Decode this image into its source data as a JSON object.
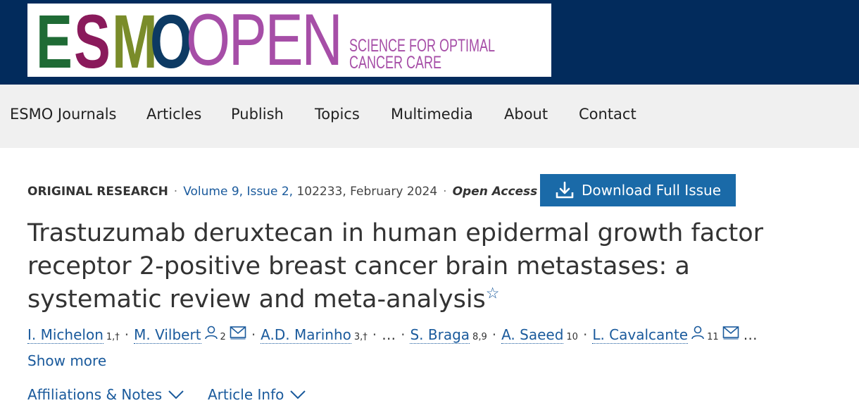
{
  "header": {
    "logo": {
      "esmo_letters": [
        "E",
        "S",
        "M",
        "O"
      ],
      "esmo_colors": [
        "#1f6b35",
        "#8a1a5b",
        "#7a8c2a",
        "#0d3a63"
      ],
      "open": "OPEN",
      "tagline_line1": "SCIENCE FOR OPTIMAL",
      "tagline_line2": "CANCER CARE"
    },
    "background": "#022b5c"
  },
  "nav": {
    "items": [
      "ESMO Journals",
      "Articles",
      "Publish",
      "Topics",
      "Multimedia",
      "About",
      "Contact"
    ]
  },
  "article": {
    "type": "ORIGINAL RESEARCH",
    "volume_issue": "Volume 9, Issue 2,",
    "article_number_date": "102233, February 2024",
    "access": "Open Access",
    "download_label": "Download Full Issue",
    "title": "Trastuzumab deruxtecan in human epidermal growth factor receptor 2-positive breast cancer brain metastases: a systematic review and meta-analysis",
    "star": "☆"
  },
  "authors": [
    {
      "name": "I. Michelon",
      "sup": "1,†"
    },
    {
      "name": "M. Vilbert",
      "sup": "2"
    },
    {
      "name": "A.D. Marinho",
      "sup": "3,†"
    },
    {
      "ellipsis": "…"
    },
    {
      "name": "S. Braga",
      "sup": "8,9"
    },
    {
      "name": "A. Saeed",
      "sup": "10"
    },
    {
      "name": "L. Cavalcante",
      "sup": "11"
    },
    {
      "trailing": "…"
    }
  ],
  "show_more": "Show more",
  "toggles": {
    "affiliations": "Affiliations & Notes",
    "article_info": "Article Info"
  },
  "colors": {
    "link": "#1a5a9c",
    "button": "#1a6aa8",
    "nav_bg": "#f0f0f0"
  }
}
